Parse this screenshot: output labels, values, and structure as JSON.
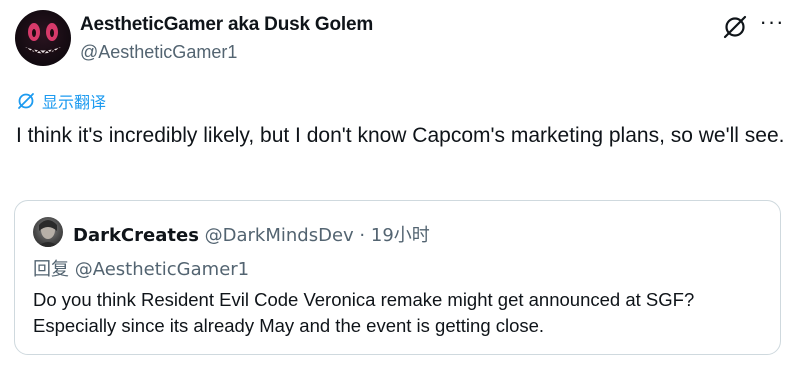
{
  "post": {
    "author_name": "AestheticGamer aka Dusk Golem",
    "author_handle": "@AestheticGamer1",
    "translate_label": "显示翻译",
    "text": "I think it's incredibly likely, but I don't know Capcom's marketing plans, so we'll see.",
    "more_label": "···",
    "icons": {
      "grok": "grok-slash-circle-icon",
      "translate": "translate-globe-icon",
      "more": "more-dots-icon"
    }
  },
  "quote": {
    "author_name": "DarkCreates",
    "author_handle": "@DarkMindsDev",
    "separator": "·",
    "time": "19小时",
    "reply_label": "回复",
    "reply_handle": "@AestheticGamer1",
    "text": "Do you think Resident Evil Code Veronica remake might get announced at SGF? Especially since its already May and the event is getting close."
  },
  "colors": {
    "accent": "#1d9bf0",
    "text": "#0f1419",
    "secondary": "#536471",
    "border": "#cfd9de"
  }
}
